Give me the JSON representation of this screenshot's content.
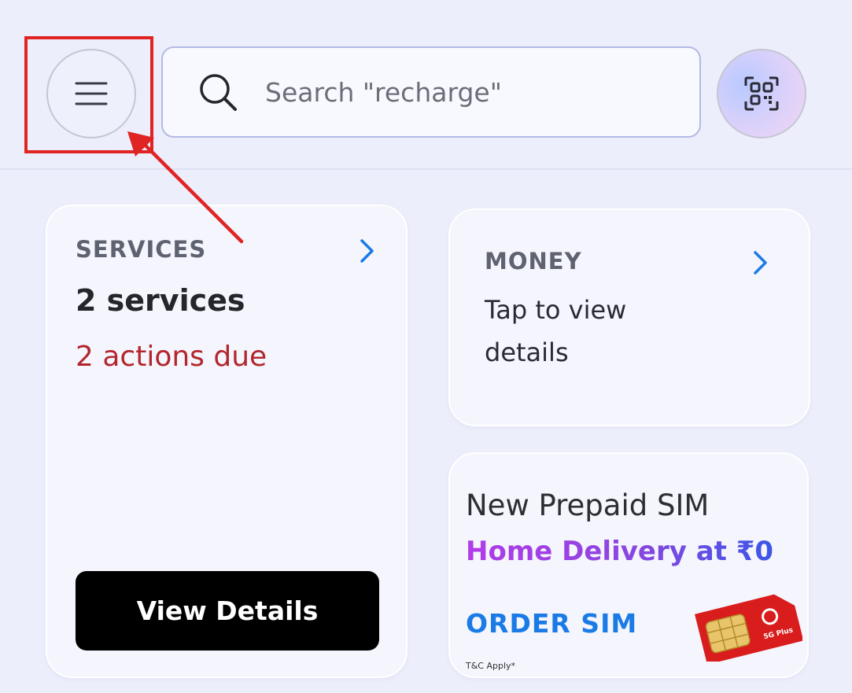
{
  "header": {
    "search": {
      "placeholder": "Search \"recharge\""
    },
    "menu_icon": "hamburger-menu-icon",
    "qr_icon": "qr-scanner-icon"
  },
  "cards": {
    "services": {
      "label": "SERVICES",
      "count": "2 services",
      "due": "2 actions due",
      "button": "View Details"
    },
    "money": {
      "label": "MONEY",
      "description": "Tap to view details"
    },
    "sim_banner": {
      "title": "New Prepaid SIM",
      "subtitle": "Home Delivery at ₹0",
      "cta": "ORDER  SIM",
      "terms": "T&C Apply*",
      "sim_badge": "5G Plus"
    }
  },
  "colors": {
    "background": "#eceefb",
    "highlight": "#e02424",
    "due_text": "#b3262d",
    "chevron": "#1a7be6",
    "cta_blue": "#1a7be6",
    "button_bg": "#000000",
    "sim_red": "#d91c1c"
  }
}
